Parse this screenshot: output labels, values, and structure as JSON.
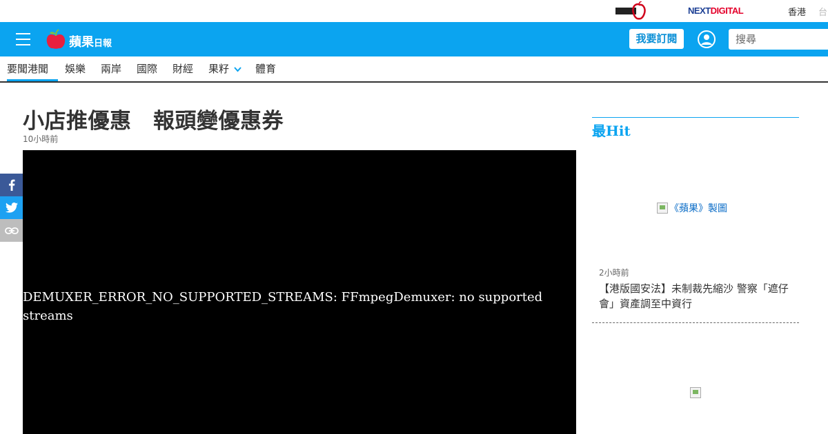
{
  "topbar": {
    "group_logo_icon": "apple-daily-group-logo-icon",
    "brand_next": "NEXT",
    "brand_digital": "DIGITAL",
    "region_hk": "香港",
    "region_tw": "台"
  },
  "header": {
    "menu_icon": "hamburger-icon",
    "brand_main": "蘋果",
    "brand_sub": "日報",
    "subscribe_label": "我要訂閱",
    "user_icon": "user-icon",
    "search_placeholder": "搜尋"
  },
  "nav": {
    "items": [
      {
        "label": "要聞港聞",
        "active": true
      },
      {
        "label": "娛樂"
      },
      {
        "label": "兩岸"
      },
      {
        "label": "國際"
      },
      {
        "label": "財經"
      },
      {
        "label": "果籽"
      },
      {
        "label": "體育"
      }
    ]
  },
  "article": {
    "title": "小店推優惠　報頭變優惠券",
    "time": "10小時前",
    "video_error": "DEMUXER_ERROR_NO_SUPPORTED_STREAMS: FFmpegDemuxer: no supported streams"
  },
  "share": {
    "facebook_icon": "facebook-icon",
    "twitter_icon": "twitter-icon",
    "link_icon": "link-icon"
  },
  "sidebar": {
    "title": "最Hit",
    "image_alt": "《蘋果》製圖",
    "item_time": "2小時前",
    "item_headline": "【港版國安法】未制裁先縮沙 警察「遮仔會」資產調至中資行"
  },
  "colors": {
    "header_blue": "#0ba4f0",
    "next_red": "#e4002b",
    "next_blue": "#1c3f94",
    "facebook": "#3b5998",
    "twitter": "#1da1f2"
  }
}
